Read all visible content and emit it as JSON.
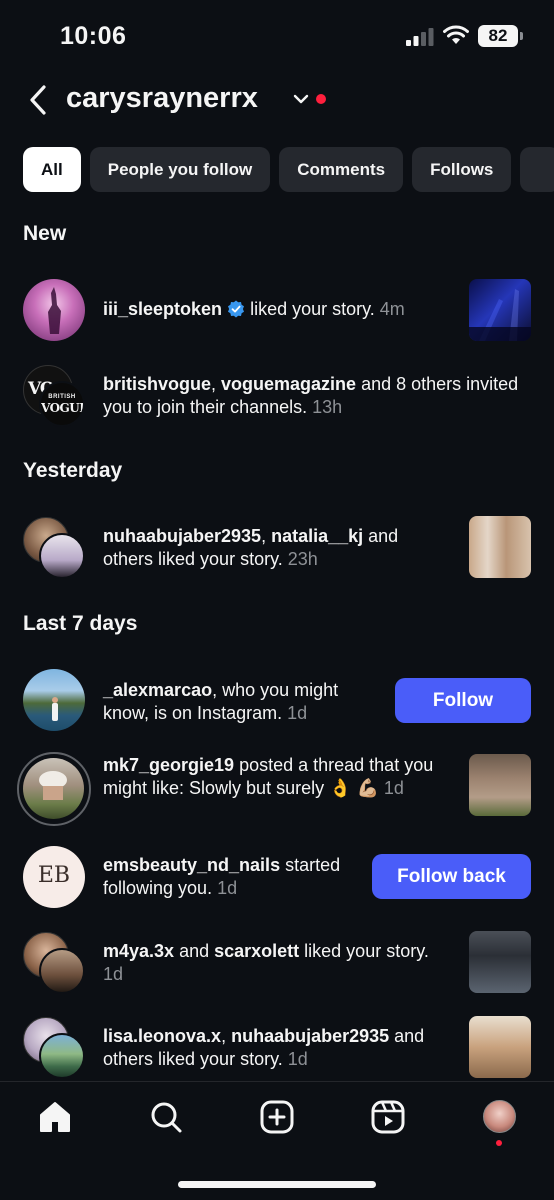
{
  "status": {
    "time": "10:06",
    "battery": "82"
  },
  "header": {
    "account": "carysraynerrx"
  },
  "filters": [
    "All",
    "People you follow",
    "Comments",
    "Follows"
  ],
  "sections": {
    "new": "New",
    "yesterday": "Yesterday",
    "last7": "Last 7 days"
  },
  "notifications": {
    "n1": {
      "user": "iii_sleeptoken",
      "text": " liked your story. ",
      "time": "4m"
    },
    "n2": {
      "user1": "britishvogue",
      "sep": ", ",
      "user2": "voguemagazine",
      "text": " and 8 others invited you to join their channels. ",
      "time": "13h",
      "avatar_text_top": "VO",
      "avatar_text_1": "BRITISH",
      "avatar_text_2": "VOGUE"
    },
    "n3": {
      "user1": "nuhaabujaber2935",
      "sep": ", ",
      "user2": "natalia__kj",
      "text": " and others liked your story. ",
      "time": "23h"
    },
    "n4": {
      "user": "_alexmarcao",
      "text": ", who you might know, is on Instagram. ",
      "time": "1d",
      "button": "Follow"
    },
    "n5": {
      "user": "mk7_georgie19",
      "text": " posted a thread that you might like: Slowly but surely 👌 💪🏼 ",
      "time": "1d"
    },
    "n6": {
      "user": "emsbeauty_nd_nails",
      "text": " started following you. ",
      "time": "1d",
      "button": "Follow back",
      "avatar_text": "EB"
    },
    "n7": {
      "user1": "m4ya.3x",
      "sep": " and ",
      "user2": "scarxolett",
      "text": " liked your story. ",
      "time": "1d"
    },
    "n8": {
      "user1": "lisa.leonova.x",
      "sep": ", ",
      "user2": "nuhaabujaber2935",
      "text": " and others liked your story. ",
      "time": "1d"
    }
  },
  "nav": [
    "home-icon",
    "search-icon",
    "create-icon",
    "reels-icon",
    "profile-avatar"
  ],
  "colors": {
    "background": "#0c0f14",
    "chip": "#25282e",
    "accent": "#4a5df9",
    "notification_dot": "#ff1f3d",
    "verified": "#3897f0"
  }
}
